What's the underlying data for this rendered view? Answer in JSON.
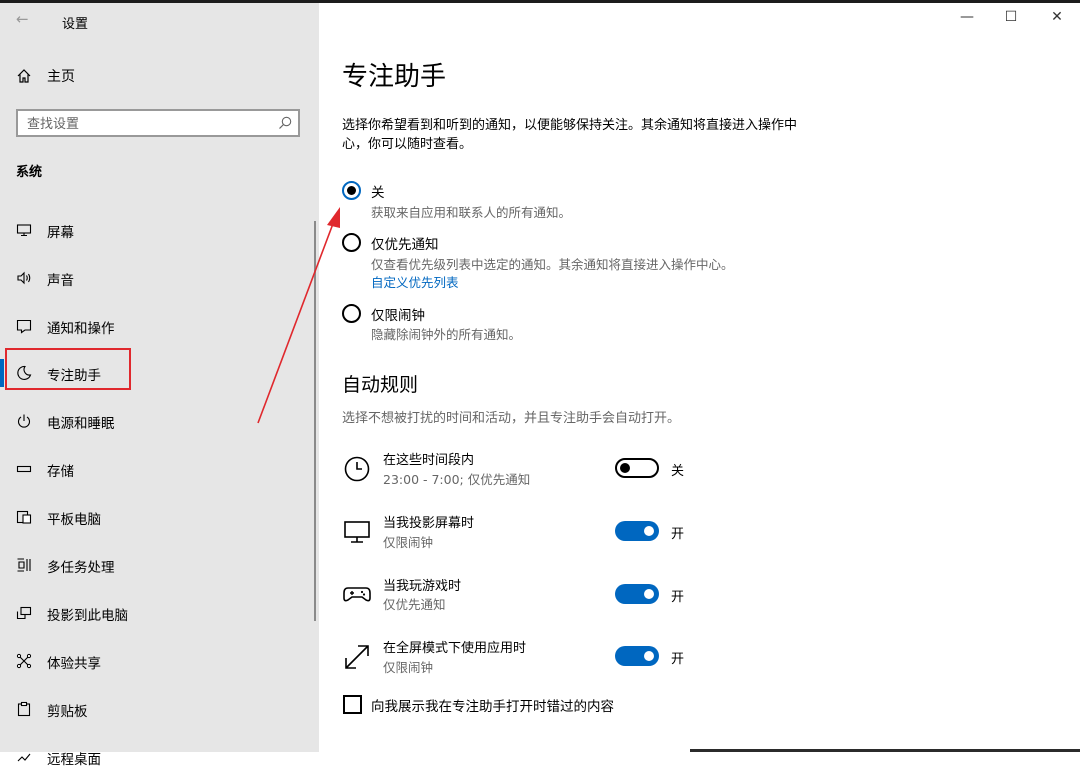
{
  "window": {
    "back_glyph": "←",
    "title": "设置",
    "minimize": "—",
    "maximize": "☐",
    "close": "✕"
  },
  "sidebar": {
    "home_label": "主页",
    "search_placeholder": "查找设置",
    "section_title": "系统",
    "items": [
      {
        "label": "屏幕",
        "icon": "monitor-icon"
      },
      {
        "label": "声音",
        "icon": "speaker-icon"
      },
      {
        "label": "通知和操作",
        "icon": "message-icon"
      },
      {
        "label": "专注助手",
        "icon": "moon-icon",
        "active": true
      },
      {
        "label": "电源和睡眠",
        "icon": "power-icon"
      },
      {
        "label": "存储",
        "icon": "storage-icon"
      },
      {
        "label": "平板电脑",
        "icon": "tablet-icon"
      },
      {
        "label": "多任务处理",
        "icon": "multitask-icon"
      },
      {
        "label": "投影到此电脑",
        "icon": "project-icon"
      },
      {
        "label": "体验共享",
        "icon": "share-icon"
      },
      {
        "label": "剪贴板",
        "icon": "clipboard-icon"
      },
      {
        "label": "远程桌面",
        "icon": "remote-icon"
      }
    ]
  },
  "main": {
    "title": "专注助手",
    "description": "选择你希望看到和听到的通知，以便能够保持关注。其余通知将直接进入操作中心，你可以随时查看。",
    "options": [
      {
        "label": "关",
        "sub": "获取来自应用和联系人的所有通知。",
        "selected": true
      },
      {
        "label": "仅优先通知",
        "sub": "仅查看优先级列表中选定的通知。其余通知将直接进入操作中心。",
        "link": "自定义优先列表",
        "selected": false
      },
      {
        "label": "仅限闹钟",
        "sub": "隐藏除闹钟外的所有通知。",
        "selected": false
      }
    ],
    "auto_rules_title": "自动规则",
    "auto_rules_desc": "选择不想被打扰的时间和活动，并且专注助手会自动打开。",
    "rules": [
      {
        "title": "在这些时间段内",
        "sub": "23:00 - 7:00; 仅优先通知",
        "on": false,
        "state": "关",
        "icon": "clock-icon"
      },
      {
        "title": "当我投影屏幕时",
        "sub": "仅限闹钟",
        "on": true,
        "state": "开",
        "icon": "display-icon"
      },
      {
        "title": "当我玩游戏时",
        "sub": "仅优先通知",
        "on": true,
        "state": "开",
        "icon": "gamepad-icon"
      },
      {
        "title": "在全屏模式下使用应用时",
        "sub": "仅限闹钟",
        "on": true,
        "state": "开",
        "icon": "fullscreen-icon"
      }
    ],
    "checkbox_label": "向我展示我在专注助手打开时错过的内容",
    "checkbox_checked": false
  },
  "annotation": {
    "color": "#e0282d"
  }
}
